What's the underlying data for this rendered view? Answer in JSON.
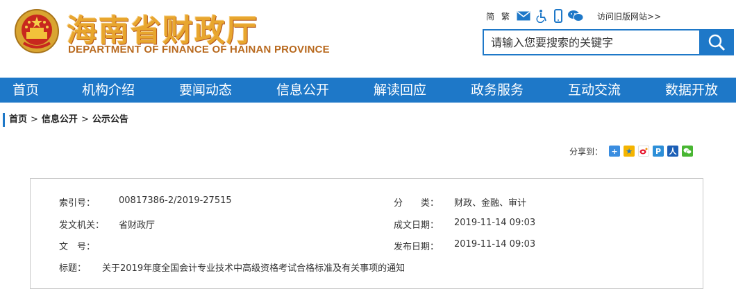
{
  "header": {
    "title": "海南省财政厅",
    "subtitle": "DEPARTMENT OF FINANCE OF HAINAN PROVINCE"
  },
  "toolbar": {
    "simplified": "简",
    "traditional": "繁",
    "icons": [
      "mail-icon",
      "accessibility-icon",
      "mobile-icon",
      "wechat-icon"
    ],
    "old_site": "访问旧版网站>>"
  },
  "search": {
    "placeholder": "请输入您要搜索的关键字"
  },
  "nav": {
    "items": [
      "首页",
      "机构介绍",
      "要闻动态",
      "信息公开",
      "解读回应",
      "政务服务",
      "互动交流",
      "数据开放"
    ]
  },
  "breadcrumb": {
    "items": [
      "首页",
      "信息公开",
      "公示公告"
    ],
    "separator": ">"
  },
  "share": {
    "label": "分享到：",
    "icons": [
      "plus-share-icon",
      "qzone-icon",
      "weibo-icon",
      "tencent-icon",
      "renren-icon",
      "wechat-share-icon"
    ]
  },
  "info": {
    "index_label": "索引号：",
    "index_value": "00817386-2/2019-27515",
    "category_label": "分　　类：",
    "category_value": "财政、金融、审计",
    "issuer_label": "发文机关：",
    "issuer_value": "省财政厅",
    "created_label": "成文日期：",
    "created_value": "2019-11-14 09:03",
    "docno_label": "文　号：",
    "docno_value": "",
    "published_label": "发布日期：",
    "published_value": "2019-11-14 09:03",
    "title_label": "标题：",
    "title_value": "关于2019年度全国会计专业技术中高级资格考试合格标准及有关事项的通知"
  },
  "colors": {
    "brand_blue": "#1e78c8",
    "title_gold": "#e8a62e",
    "subtitle_brown": "#b8691e"
  }
}
